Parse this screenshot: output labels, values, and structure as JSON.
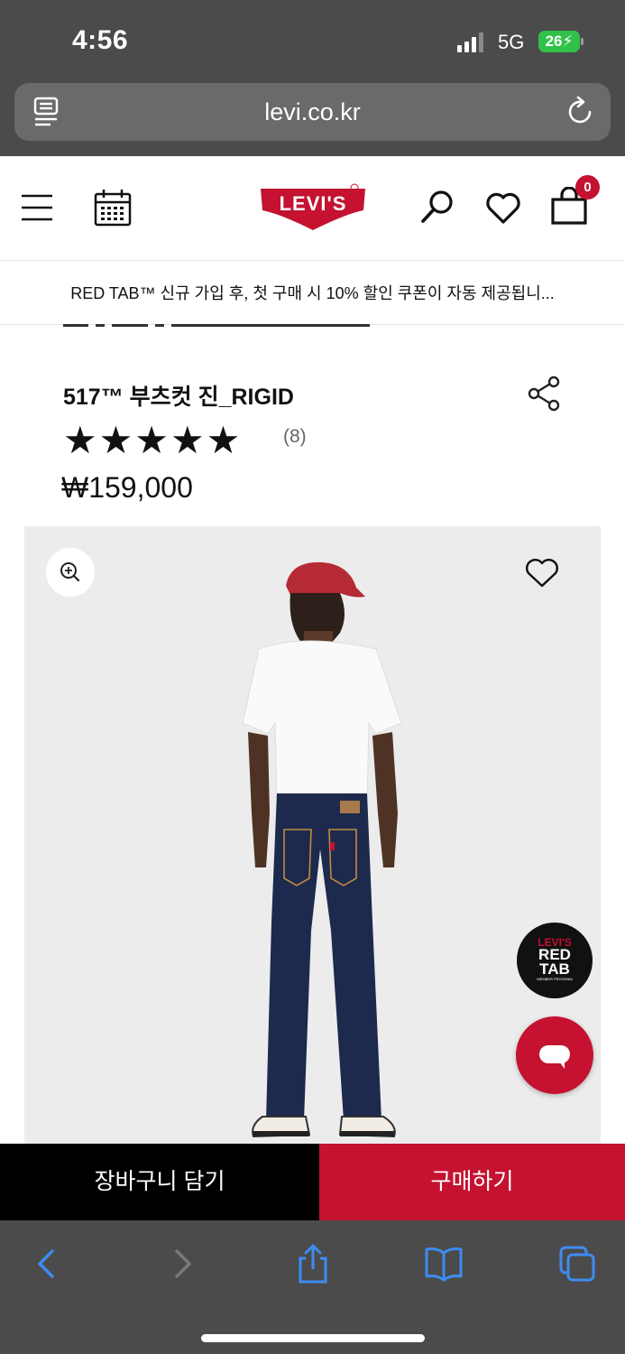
{
  "status_bar": {
    "time": "4:56",
    "network": "5G",
    "battery": "26"
  },
  "browser": {
    "url": "levi.co.kr"
  },
  "header": {
    "logo_text": "LEVI'S",
    "cart_count": "0",
    "brand_color": "#c41230"
  },
  "promo": {
    "text": "RED TAB™ 신규 가입 후, 첫 구매 시 10% 할인 쿠폰이 자동 제공됩니..."
  },
  "product": {
    "title": "517™ 부츠컷 진_RIGID",
    "rating_stars": "★★★★★",
    "rating_value": 5,
    "review_count": "(8)",
    "price": "₩159,000"
  },
  "badges": {
    "redtab_line1": "LEVI'S",
    "redtab_line2": "RED",
    "redtab_line3": "TAB",
    "redtab_line4": "MEMBER PROGRAM"
  },
  "actions": {
    "add_to_cart": "장바구니 담기",
    "buy_now": "구매하기"
  },
  "icons": [
    "reader-icon",
    "reload-icon",
    "menu-icon",
    "calendar-icon",
    "search-icon",
    "heart-icon",
    "bag-icon",
    "share-icon",
    "zoom-icon",
    "wishlist-heart-icon",
    "chat-icon",
    "back-icon",
    "forward-icon",
    "share-sheet-icon",
    "bookmarks-icon",
    "tabs-icon"
  ]
}
